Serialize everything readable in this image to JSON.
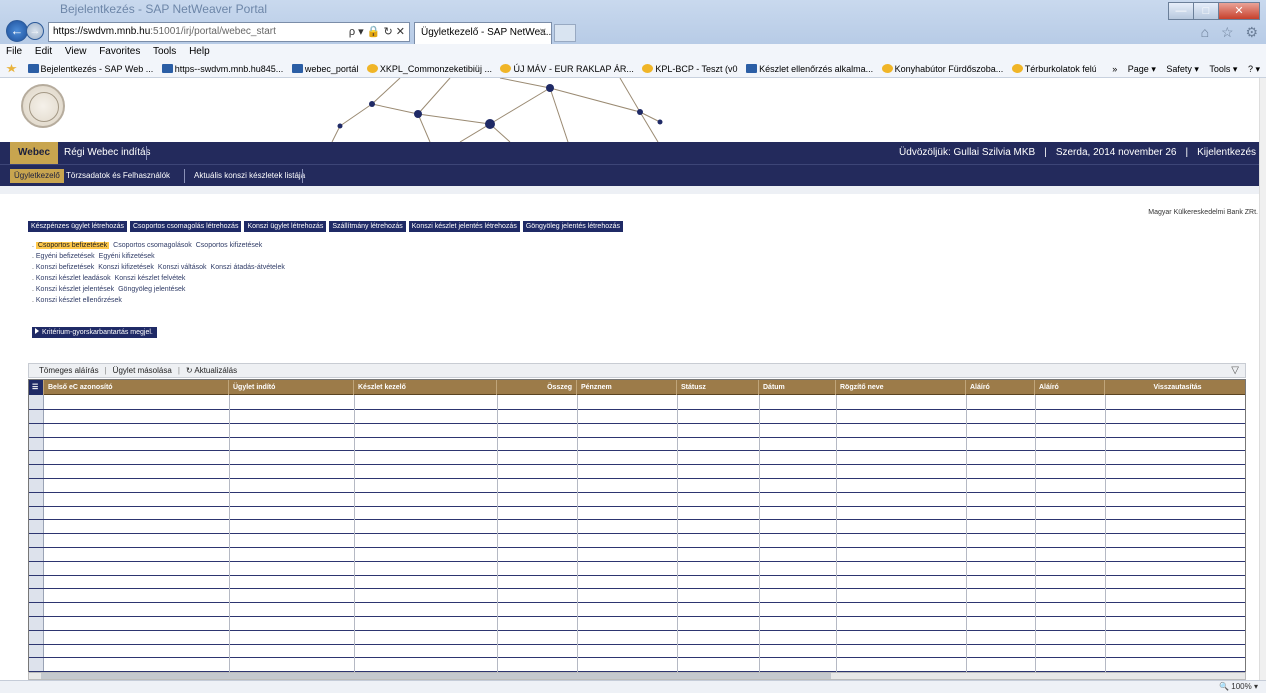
{
  "browser": {
    "ghost_title": "Bejelentkezés - SAP NetWeaver Portal",
    "url_host": "https://swdvm.mnb.hu",
    "url_rest": ":51001/irj/portal/webec_start",
    "address_tools": "ρ ▾ 🔒 ↻ ✕",
    "tab_title": "Ügyletkezelő - SAP NetWea...",
    "tab_close": "✕",
    "chrome_icons": "⌂ ☆ ⚙",
    "win_min": "—",
    "win_max": "□",
    "win_close": "✕",
    "menu": [
      "File",
      "Edit",
      "View",
      "Favorites",
      "Tools",
      "Help"
    ],
    "favorites": [
      {
        "label": "Bejelentkezés - SAP Web ...",
        "icon": "sap"
      },
      {
        "label": "https--swdvm.mnb.hu845...",
        "icon": "sap"
      },
      {
        "label": "webec_portál",
        "icon": "sap"
      },
      {
        "label": "XKPL_Commonzeketibiüj ...",
        "icon": "ie"
      },
      {
        "label": "ÚJ MÁV - EUR RAKLAP ÁR...",
        "icon": "ie"
      },
      {
        "label": "KPL-BCP - Teszt (v0",
        "icon": "ie"
      },
      {
        "label": "Készlet ellenőrzés alkalma...",
        "icon": "sap"
      },
      {
        "label": "Konyhabútor Fürdőszoba...",
        "icon": "ie"
      },
      {
        "label": "Térburkolatok felújítása",
        "icon": "ie"
      }
    ],
    "fav_tools": [
      "»",
      "Page ▾",
      "Safety ▾",
      "Tools ▾",
      "? ▾"
    ],
    "zoom": "100%"
  },
  "portal": {
    "top_tabs": [
      "Webec",
      "Régi Webec indítás"
    ],
    "welcome": "Üdvözöljük: Gullai Szilvia MKB",
    "date": "Szerda, 2014 november 26",
    "logout": "Kijelentkezés",
    "sub_tabs": [
      "Ügyletkezelő",
      "Törzsadatok és Felhasználók",
      "Aktuális konszi készletek listája"
    ],
    "company": "Magyar Külkereskedelmi Bank ZRt."
  },
  "actions": [
    "Készpénzes ügylet létrehozás",
    "Csoportos csomagolás létrehozás",
    "Konszi ügylet létrehozás",
    "Szállítmány létrehozás",
    "Konszi készlet jelentés létrehozás",
    "Göngyöleg jelentés létrehozás"
  ],
  "links": [
    [
      "Csoportos befizetések",
      "Csoportos csomagolások",
      "Csoportos kifizetések"
    ],
    [
      "Egyéni befizetések",
      "Egyéni kifizetések"
    ],
    [
      "Konszi befizetések",
      "Konszi kifizetések",
      "Konszi váltások",
      "Konszi átadás-átvételek"
    ],
    [
      "Konszi készlet leadások",
      "Konszi készlet felvétek"
    ],
    [
      "Konszi készlet jelentések",
      "Göngyöleg jelentések"
    ],
    [
      "Konszi készlet ellenőrzések"
    ]
  ],
  "kriterium": "Kritérium-gyorskarbantartás megjel.",
  "table": {
    "toolbar": [
      "Tömeges aláírás",
      "Ügylet másolása",
      "Aktualizálás"
    ],
    "columns": [
      "Belső eC azonosító",
      "Ügylet indító",
      "Készlet kezelő",
      "Összeg",
      "Pénznem",
      "Státusz",
      "Dátum",
      "Rögzítő neve",
      "Aláíró",
      "Aláíró",
      "Visszautasítás"
    ]
  }
}
